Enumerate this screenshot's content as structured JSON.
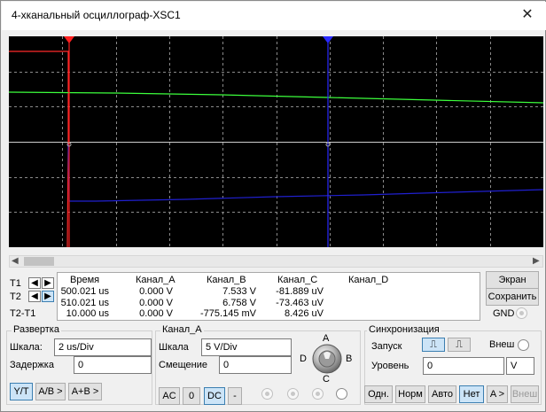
{
  "window": {
    "title": "4-хканальный осциллограф-XSC1",
    "close_glyph": "✕"
  },
  "scrollbar": {
    "left_arrow": "◀",
    "right_arrow": "▶"
  },
  "readout": {
    "headers": [
      "Время",
      "Канал_A",
      "Канал_B",
      "Канал_C",
      "Канал_D"
    ],
    "rows": [
      {
        "label": "T1",
        "time": "500.021 us",
        "a": "0.000 V",
        "b": "7.533 V",
        "c": "-81.889 uV",
        "d": ""
      },
      {
        "label": "T2",
        "time": "510.021 us",
        "a": "0.000 V",
        "b": "6.758 V",
        "c": "-73.463 uV",
        "d": ""
      },
      {
        "label": "T2-T1",
        "time": "10.000 us",
        "a": "0.000 V",
        "b": "-775.145 mV",
        "c": "8.426 uV",
        "d": ""
      }
    ]
  },
  "right_buttons": {
    "screen": "Экран",
    "save": "Сохранить",
    "gnd": "GND"
  },
  "timebase": {
    "title": "Развертка",
    "scale_label": "Шкала:",
    "scale_value": "2 us/Div",
    "delay_label": "Задержка",
    "delay_value": "0",
    "modes": [
      "Y/T",
      "A/B >",
      "A+B >"
    ]
  },
  "channel": {
    "title": "Канал_A",
    "scale_label": "Шкала",
    "scale_value": "5  V/Div",
    "offset_label": "Смещение",
    "offset_value": "0",
    "coupling": [
      "AC",
      "0",
      "DC",
      "-"
    ],
    "knob_labels": {
      "a": "A",
      "b": "B",
      "c": "C",
      "d": "D"
    }
  },
  "trigger": {
    "title": "Синхронизация",
    "launch_label": "Запуск",
    "external_label": "Внеш",
    "level_label": "Уровень",
    "level_value": "0",
    "level_unit": "V",
    "modes": [
      "Одн.",
      "Норм",
      "Авто",
      "Нет",
      "A >",
      "Внеш"
    ]
  },
  "colors": {
    "screen_bg": "#000000",
    "grid": "#8a8a8a",
    "channel_a": "#ff2a2a",
    "channel_b": "#3cff3c",
    "channel_c": "#2020d0",
    "cursor_t1": "#ff2020",
    "cursor_t2": "#2a2aff"
  }
}
